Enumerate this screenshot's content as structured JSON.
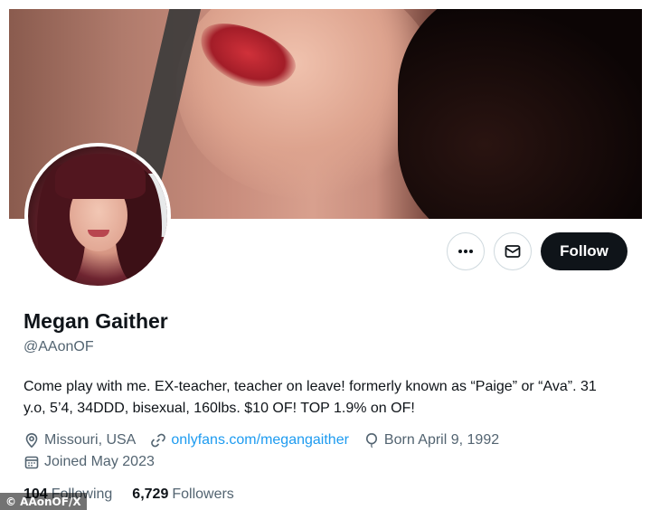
{
  "profile": {
    "display_name": "Megan Gaither",
    "handle": "@AAonOF",
    "bio": "Come play with me. EX-teacher, teacher on leave! formerly known as “Paige” or “Ava”. 31 y.o, 5’4, 34DDD, bisexual, 160lbs. $10 OF!  TOP 1.9% on OF!",
    "location": "Missouri, USA",
    "link": "onlyfans.com/megangaither",
    "born": "Born April 9, 1992",
    "joined": "Joined May 2023"
  },
  "stats": {
    "following_count": "104",
    "following_label": "Following",
    "followers_count": "6,729",
    "followers_label": "Followers"
  },
  "actions": {
    "follow_label": "Follow",
    "more_icon": "more-horizontal-icon",
    "message_icon": "envelope-icon"
  },
  "icons": {
    "location": "location-pin-icon",
    "link": "link-icon",
    "born": "balloon-icon",
    "joined": "calendar-icon"
  },
  "watermark": "© AAonOF/X",
  "colors": {
    "accent_link": "#1d9bf0",
    "follow_bg": "#0f1419",
    "secondary_text": "#536471"
  }
}
